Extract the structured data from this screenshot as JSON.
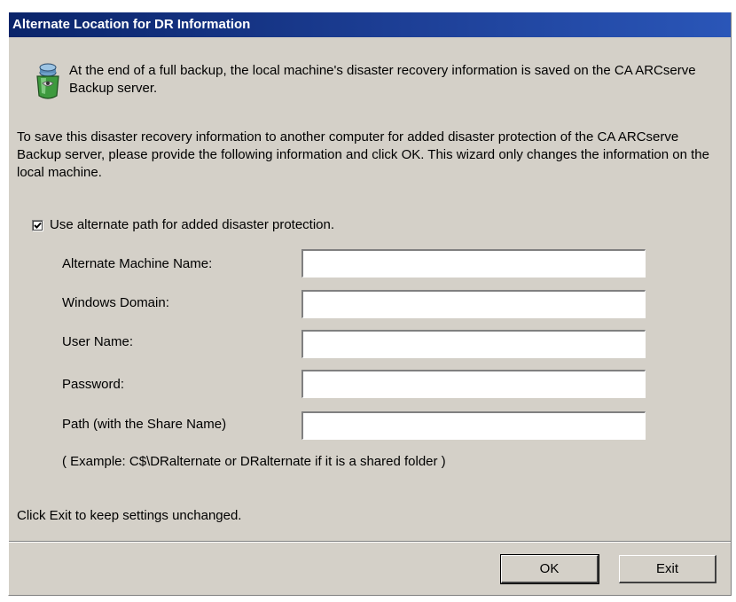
{
  "dialog": {
    "title": "Alternate Location for DR Information",
    "icon": "backup-server-icon",
    "intro": "At the end of a full backup, the local machine's disaster recovery information is saved on the CA ARCserve Backup server.",
    "description": "To save this disaster recovery information to another computer for added disaster protection of the CA ARCserve Backup server, please provide the following information and click OK. This wizard only changes the information on the local machine.",
    "checkbox": {
      "label": "Use alternate path for added disaster protection.",
      "checked": true
    },
    "fields": {
      "machine_name_label": "Alternate Machine Name:",
      "machine_name_value": "",
      "domain_label": "Windows Domain:",
      "domain_value": "",
      "user_label": "User Name:",
      "user_value": "",
      "password_label": "Password:",
      "password_value": "",
      "path_label": "Path (with the Share Name)",
      "path_value": ""
    },
    "example": "( Example: C$\\DRalternate or DRalternate if it is a shared folder )",
    "exit_note": "Click Exit to keep settings unchanged.",
    "ok_label": "OK",
    "exit_label": "Exit"
  }
}
